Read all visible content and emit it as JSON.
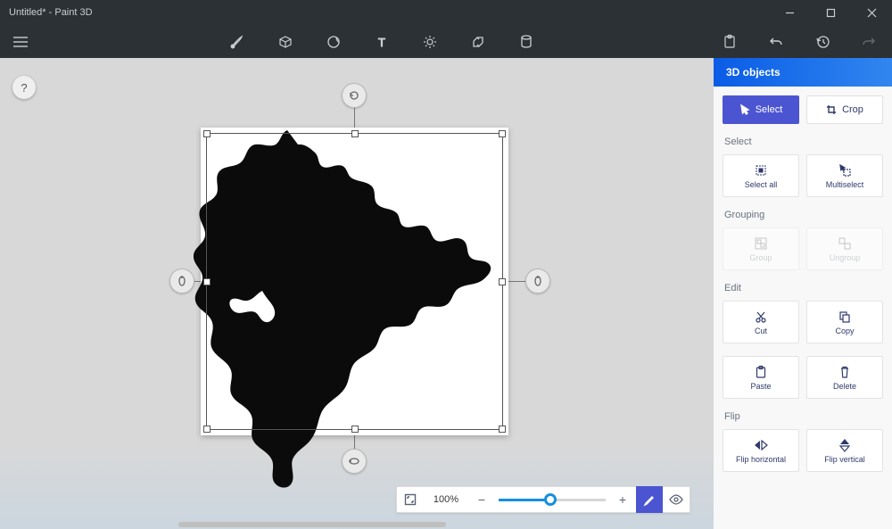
{
  "title": "Untitled* - Paint 3D",
  "window_buttons": {
    "min": "minus-icon",
    "max": "square-icon",
    "close": "x-icon"
  },
  "toolbar": {
    "tools": [
      "brush",
      "3d-shapes",
      "stickers",
      "text",
      "effects",
      "canvas",
      "3d-library"
    ],
    "right": [
      "paste",
      "undo",
      "history",
      "redo"
    ]
  },
  "help": "?",
  "rotate_handles": [
    "rotate",
    "depth-left",
    "depth-right",
    "depth-bottom"
  ],
  "zoom": {
    "value": "100%",
    "fit_icon": "fit-to-screen-icon",
    "minus": "−",
    "plus": "+",
    "mode_icon": "pencil-icon",
    "view_icon": "eye-icon"
  },
  "panel": {
    "title": "3D objects",
    "modes": {
      "select": "Select",
      "crop": "Crop"
    },
    "sections": {
      "select_label": "Select",
      "select_all": "Select all",
      "multiselect": "Multiselect",
      "grouping_label": "Grouping",
      "group": "Group",
      "ungroup": "Ungroup",
      "edit_label": "Edit",
      "cut": "Cut",
      "copy": "Copy",
      "paste": "Paste",
      "delete": "Delete",
      "flip_label": "Flip",
      "flip_h": "Flip horizontal",
      "flip_v": "Flip vertical"
    }
  }
}
